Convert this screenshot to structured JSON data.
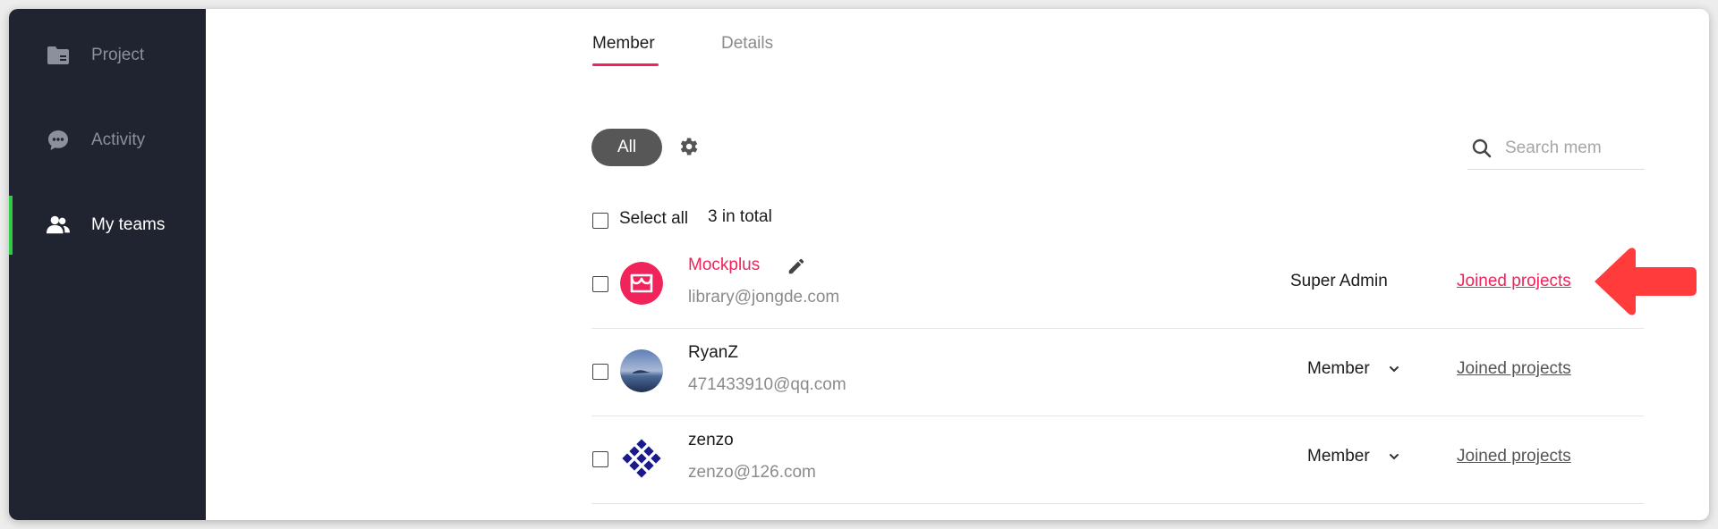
{
  "sidebar": {
    "items": [
      {
        "label": "Project",
        "icon": "folder-icon",
        "active": false
      },
      {
        "label": "Activity",
        "icon": "chat-bubble-icon",
        "active": false
      },
      {
        "label": "My teams",
        "icon": "team-icon",
        "active": true
      }
    ]
  },
  "tabs": [
    {
      "label": "Member",
      "active": true
    },
    {
      "label": "Details",
      "active": false
    }
  ],
  "filter": {
    "all_label": "All"
  },
  "search": {
    "placeholder": "Search mem"
  },
  "list": {
    "select_all_label": "Select all",
    "total_label": "3 in total",
    "members": [
      {
        "name": "Mockplus",
        "email": "library@jongde.com",
        "role": "Super Admin",
        "joined_label": "Joined projects",
        "has_role_dropdown": false
      },
      {
        "name": "RyanZ",
        "email": "471433910@qq.com",
        "role": "Member",
        "joined_label": "Joined projects",
        "has_role_dropdown": true
      },
      {
        "name": "zenzo",
        "email": "zenzo@126.com",
        "role": "Member",
        "joined_label": "Joined projects",
        "has_role_dropdown": true
      }
    ]
  },
  "colors": {
    "sidebar_bg": "#1f2430",
    "accent_pink": "#f0245a",
    "active_indicator": "#2ecc40",
    "arrow_red": "#ff3b3b"
  }
}
